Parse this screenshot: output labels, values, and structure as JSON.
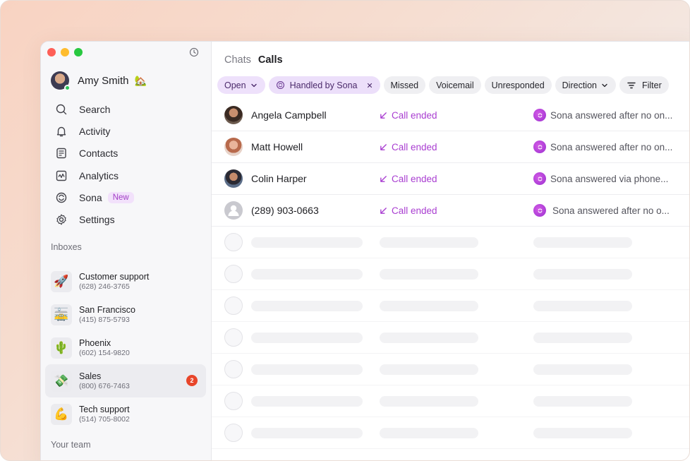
{
  "sidebar": {
    "user": {
      "name": "Amy Smith",
      "emoji": "🏡"
    },
    "nav": [
      {
        "label": "Search",
        "icon": "search-icon"
      },
      {
        "label": "Activity",
        "icon": "bell-icon"
      },
      {
        "label": "Contacts",
        "icon": "contacts-icon"
      },
      {
        "label": "Analytics",
        "icon": "analytics-icon"
      },
      {
        "label": "Sona",
        "icon": "sona-icon",
        "badge": "New"
      },
      {
        "label": "Settings",
        "icon": "gear-icon"
      }
    ],
    "inboxes_label": "Inboxes",
    "inboxes": [
      {
        "name": "Customer support",
        "phone": "(628) 246-3765",
        "emoji": "🚀"
      },
      {
        "name": "San Francisco",
        "phone": "(415) 875-5793",
        "emoji": "🚋"
      },
      {
        "name": "Phoenix",
        "phone": "(602) 154-9820",
        "emoji": "🌵"
      },
      {
        "name": "Sales",
        "phone": "(800) 676-7463",
        "emoji": "💸",
        "count": "2"
      },
      {
        "name": "Tech support",
        "phone": "(514) 705-8002",
        "emoji": "💪"
      }
    ],
    "team_label": "Your team"
  },
  "main": {
    "tabs": [
      {
        "label": "Chats"
      },
      {
        "label": "Calls"
      }
    ],
    "filters": {
      "open": "Open",
      "handled": "Handled by Sona",
      "missed": "Missed",
      "voicemail": "Voicemail",
      "unresponded": "Unresponded",
      "direction": "Direction",
      "filter": "Filter"
    },
    "calls": [
      {
        "name": "Angela Campbell",
        "status": "Call ended",
        "summary": "Sona answered after no on..."
      },
      {
        "name": "Matt Howell",
        "status": "Call ended",
        "summary": "Sona answered after no on..."
      },
      {
        "name": "Colin Harper",
        "status": "Call ended",
        "summary": "Sona answered via phone..."
      },
      {
        "name": "(289) 903-0663",
        "status": "Call ended",
        "summary": "Sona answered after no o..."
      }
    ]
  },
  "colors": {
    "accent_purple": "#a93ed1",
    "badge_red": "#e8452a"
  }
}
